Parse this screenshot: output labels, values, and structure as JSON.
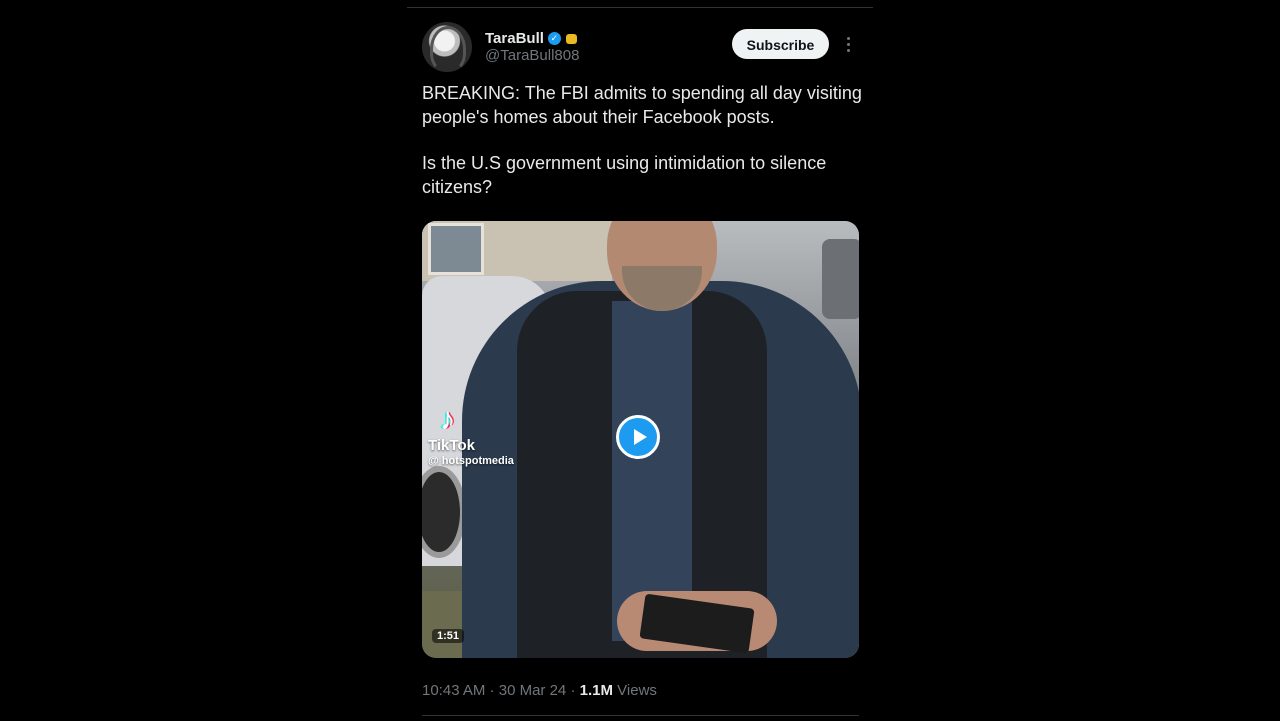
{
  "author": {
    "display_name": "TaraBull",
    "handle": "@TaraBull808",
    "verified_icon": "verified-check-icon",
    "affiliate_badge_icon": "gold-badge-icon"
  },
  "actions": {
    "subscribe_label": "Subscribe",
    "more_icon": "more-vertical-icon"
  },
  "tweet": {
    "paragraphs": [
      "BREAKING: The FBI admits to spending all day visiting people's homes about their Facebook posts.",
      "Is the U.S government using intimidation to silence citizens?"
    ]
  },
  "media": {
    "watermark_brand": "TikTok",
    "watermark_user": "@ hotspotmedia",
    "duration": "1:51",
    "play_icon": "play-icon"
  },
  "meta": {
    "time": "10:43 AM",
    "separator": "·",
    "date": "30 Mar 24",
    "views_count": "1.1M",
    "views_label": "Views"
  },
  "colors": {
    "background": "#000000",
    "text": "#e7e9ea",
    "secondary_text": "#71767b",
    "accent": "#1d9bf0",
    "subscribe_bg": "#eff3f4"
  }
}
